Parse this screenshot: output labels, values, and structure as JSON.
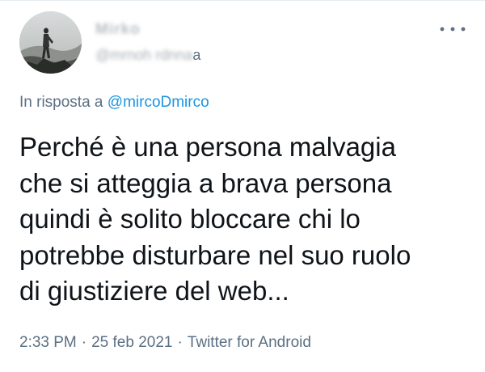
{
  "tweet": {
    "author": {
      "display_name": "Mirko",
      "handle_blurred": "@mrnoh rdnna",
      "handle_tail": "a",
      "avatar": "profile-photo"
    },
    "more_icon": "more-horizontal-icon",
    "reply": {
      "prefix": "In risposta a",
      "mention": "@mircoDmirco"
    },
    "text": "Perché è una persona malvagia\nche si atteggia a brava persona\nquindi è solito bloccare chi lo\npotrebbe disturbare nel suo ruolo\ndi giustiziere del web...",
    "meta": {
      "time": "2:33 PM",
      "separator": "·",
      "date": "25 feb 2021",
      "source": "Twitter for Android"
    }
  },
  "colors": {
    "text": "#0f1419",
    "secondary": "#5b7083",
    "link": "#1b95e0",
    "background": "#ffffff"
  }
}
